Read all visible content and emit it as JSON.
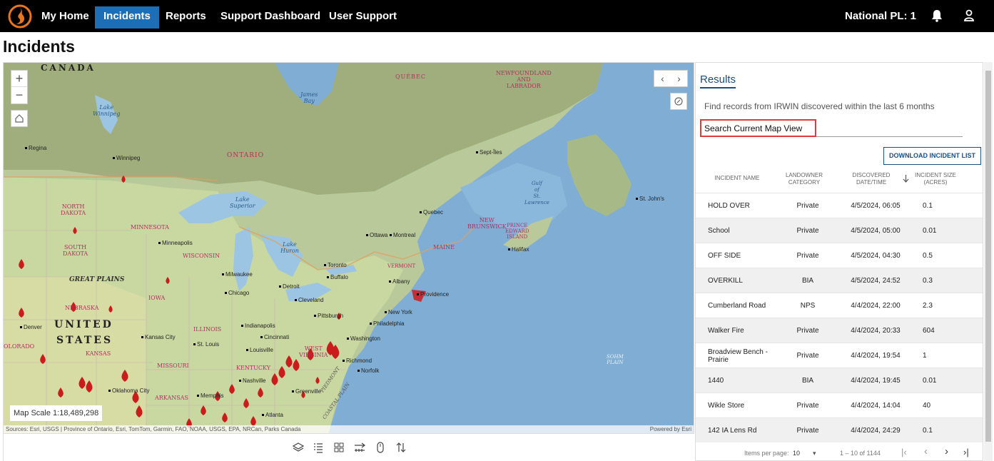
{
  "nav": {
    "items": [
      "My Home",
      "Incidents",
      "Reports",
      "Support Dashboard",
      "User Support"
    ],
    "active": "Incidents",
    "pl_label": "National PL: 1"
  },
  "page_title": "Incidents",
  "map": {
    "scale": "Map Scale 1:18,489,298",
    "attribution": "Sources: Esri, USGS | Province of Ontario, Esri, TomTom, Garmin, FAO, NOAA, USGS, EPA, NRCan, Parks Canada",
    "powered_by": "Powered by Esri",
    "labels": {
      "canada": "CANADA",
      "united": "UNITED",
      "states": "STATES",
      "ontario": "ONTARIO",
      "quebec": "QUÉBEC",
      "newfoundland": "NEWFOUNDLAND",
      "and": "AND",
      "labrador": "LABRADOR",
      "james_bay": "James",
      "james_bay2": "Bay",
      "lake_winnipeg": "Lake",
      "lake_winnipeg2": "Winnipeg",
      "lake_superior": "Lake",
      "lake_superior2": "Superior",
      "lake_huron": "Lake",
      "lake_huron2": "Huron",
      "gulf": "Gulf",
      "gulf2": "of",
      "gulf3": "St.",
      "gulf4": "Lawrence",
      "north_dakota": "NORTH",
      "north_dakota2": "DAKOTA",
      "south_dakota": "SOUTH",
      "south_dakota2": "DAKOTA",
      "great_plains": "GREAT PLAINS",
      "nebraska": "NEBRASKA",
      "kansas": "KANSAS",
      "colorado": "OLORADO",
      "iowa": "IOWA",
      "illinois": "ILLINOIS",
      "missouri": "MISSOURI",
      "minnesota": "MINNESOTA",
      "wisconsin": "WISCONSIN",
      "arkansas": "ARKANSAS",
      "kentucky": "KENTUCKY",
      "west_virginia": "WEST",
      "west_virginia2": "VIRGINIA",
      "new_brunswick": "NEW",
      "new_brunswick2": "BRUNSWICK",
      "pei": "PRINCE",
      "pei2": "EDWARD",
      "pei3": "ISLAND",
      "maine": "MAINE",
      "vermont": "VERMONT",
      "piedmont": "PIEDMONT",
      "coastal_plain": "COASTAL PLAIN",
      "sohm": "SOHM",
      "sohm2": "PLAIN"
    },
    "cities": [
      "Regina",
      "Winnipeg",
      "Sept-Îles",
      "St. John's",
      "Quebec",
      "Ottawa",
      "Montreal",
      "Minneapolis",
      "Toronto",
      "Buffalo",
      "Milwaukee",
      "Detroit",
      "Chicago",
      "Cleveland",
      "Halifax",
      "Albany",
      "Providence",
      "New York",
      "Pittsburgh",
      "Philadelphia",
      "Denver",
      "Kansas City",
      "Indianapolis",
      "Cincinnati",
      "Washington",
      "St. Louis",
      "Louisville",
      "Richmond",
      "Norfolk",
      "Oklahoma City",
      "Nashville",
      "Memphis",
      "Greenville",
      "Atlanta"
    ]
  },
  "panel": {
    "tab": "Results",
    "description": "Find records from IRWIN discovered within the last 6 months",
    "search_value": "Search Current Map View",
    "download_label": "DOWNLOAD INCIDENT LIST",
    "columns": [
      "INCIDENT NAME",
      "LANDOWNER CATEGORY",
      "DISCOVERED DATE/TIME",
      "INCIDENT SIZE (ACRES)"
    ],
    "rows": [
      {
        "name": "HOLD OVER",
        "owner": "Private",
        "date": "4/5/2024, 06:05",
        "size": "0.1"
      },
      {
        "name": "School",
        "owner": "Private",
        "date": "4/5/2024, 05:00",
        "size": "0.01"
      },
      {
        "name": "OFF SIDE",
        "owner": "Private",
        "date": "4/5/2024, 04:30",
        "size": "0.5"
      },
      {
        "name": "OVERKILL",
        "owner": "BIA",
        "date": "4/5/2024, 24:52",
        "size": "0.3"
      },
      {
        "name": "Cumberland Road",
        "owner": "NPS",
        "date": "4/4/2024, 22:00",
        "size": "2.3"
      },
      {
        "name": "Walker Fire",
        "owner": "Private",
        "date": "4/4/2024, 20:33",
        "size": "604"
      },
      {
        "name": "Broadview Bench - Prairie",
        "owner": "Private",
        "date": "4/4/2024, 19:54",
        "size": "1"
      },
      {
        "name": "1440",
        "owner": "BIA",
        "date": "4/4/2024, 19:45",
        "size": "0.01"
      },
      {
        "name": "Wikle Store",
        "owner": "Private",
        "date": "4/4/2024, 14:04",
        "size": "40"
      },
      {
        "name": "142 IA Lens Rd",
        "owner": "Private",
        "date": "4/4/2024, 24:29",
        "size": "0.1"
      }
    ],
    "pager": {
      "label": "Items per page:",
      "per_page": "10",
      "range": "1 – 10 of 1144"
    }
  }
}
